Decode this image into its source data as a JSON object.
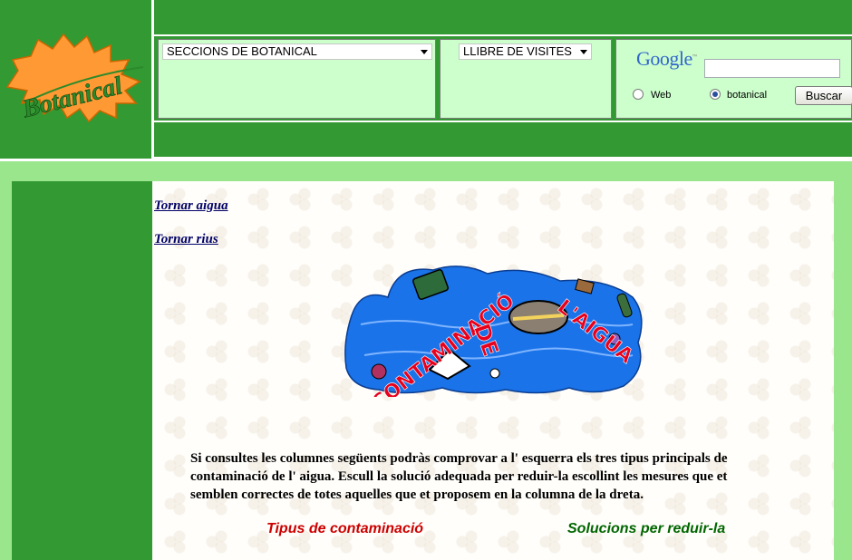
{
  "header": {
    "logo_text": "Botanical",
    "sections_select": {
      "selected": "SECCIONS DE BOTANICAL"
    },
    "visits_select": {
      "selected": "LLIBRE DE VISITES"
    },
    "search": {
      "logo_text": "Google",
      "query": "",
      "options": [
        {
          "label": "Web",
          "checked": false
        },
        {
          "label": "botanical",
          "checked": true
        }
      ],
      "button_label": "Buscar"
    }
  },
  "main": {
    "links": [
      {
        "label": "Tornar aigua"
      },
      {
        "label": "Tornar rius"
      }
    ],
    "banner": {
      "title_line1": "CONTAMINACIÓ",
      "title_line2": "DE",
      "title_line3": "L'AIGUA"
    },
    "intro": "Si consultes les columnes següents podràs comprovar a l' esquerra els tres tipus principals de contaminació de l' aigua. Escull la solució adequada per reduir-la escollint les mesures que et semblen correctes de totes aquelles que et proposem en la columna de la dreta.",
    "column_headings": {
      "left": "Tipus de contaminació",
      "right": "Solucions per reduir-la"
    }
  },
  "colors": {
    "header_green": "#339933",
    "nav_background": "#ccffcc",
    "page_band": "#99e68c",
    "heading_red": "#cc0000",
    "heading_green": "#006600",
    "banner_water": "#1a73e8",
    "banner_text": "#e8001c"
  }
}
